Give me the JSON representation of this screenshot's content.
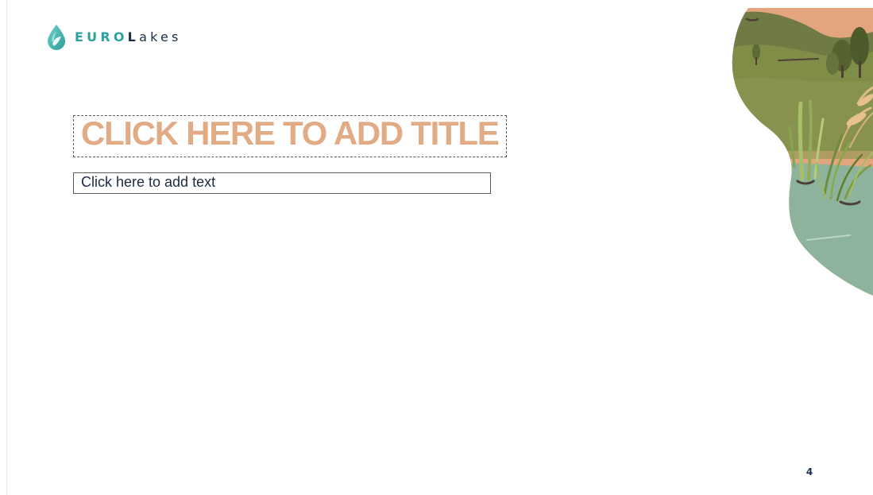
{
  "logo": {
    "brand_prefix": "EURO",
    "brand_capital": "L",
    "brand_rest": "akes",
    "icon": "water-drop-icon",
    "colors": {
      "teal": "#2aa3a0",
      "navy": "#1a2e4a"
    }
  },
  "slide": {
    "title_placeholder": "CLICK HERE TO ADD TITLE",
    "text_placeholder": "Click here to add text",
    "page_number": "4",
    "title_color": "#e1ac85",
    "text_color": "#1c2a44"
  },
  "illustration": {
    "icon": "lake-landscape-illustration",
    "colors": {
      "sky": "#e3a57d",
      "hills": "#6f7a45",
      "meadow": "#7f8d46",
      "water": "#8db39c",
      "reeds": "#a9c06a"
    }
  }
}
